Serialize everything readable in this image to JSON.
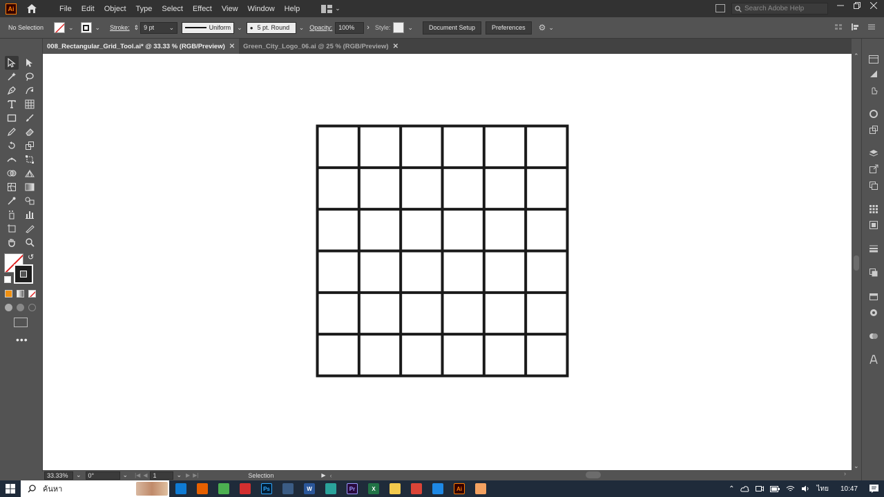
{
  "app": {
    "logo_text": "Ai",
    "search_placeholder": "Search Adobe Help"
  },
  "menu": [
    "File",
    "Edit",
    "Object",
    "Type",
    "Select",
    "Effect",
    "View",
    "Window",
    "Help"
  ],
  "control_bar": {
    "selection_label": "No Selection",
    "stroke_label": "Stroke:",
    "stroke_weight": "9 pt",
    "stroke_profile": "Uniform",
    "brush": "5 pt. Round",
    "opacity_label": "Opacity:",
    "opacity_value": "100%",
    "style_label": "Style:",
    "document_setup": "Document Setup",
    "preferences": "Preferences"
  },
  "tabs": [
    {
      "label": "008_Rectangular_Grid_Tool.ai* @ 33.33 % (RGB/Preview)",
      "active": true
    },
    {
      "label": "Green_City_Logo_06.ai @ 25 % (RGB/Preview)",
      "active": false
    }
  ],
  "canvas": {
    "grid_rows": 6,
    "grid_columns": 6,
    "stroke_color": "#1a1a1a",
    "background": "#ffffff"
  },
  "status_bar": {
    "zoom": "33.33%",
    "rotation": "0°",
    "artboard_number": "1",
    "tool_name": "Selection"
  },
  "taskbar": {
    "search_text": "ค้นหา",
    "language": "ไทย",
    "time": "10:47",
    "apps": [
      {
        "name": "edge",
        "color": "#0f7bd4"
      },
      {
        "name": "firefox",
        "color": "#e66000"
      },
      {
        "name": "paint",
        "color": "#4caf50"
      },
      {
        "name": "app-red",
        "color": "#d32f2f"
      },
      {
        "name": "photoshop",
        "color": "#001e36",
        "label": "Ps"
      },
      {
        "name": "calculator",
        "color": "#3b5c84"
      },
      {
        "name": "word",
        "color": "#2b579a",
        "label": "W"
      },
      {
        "name": "app-teal",
        "color": "#2aa39b"
      },
      {
        "name": "premiere",
        "color": "#2a0a3d",
        "label": "Pr"
      },
      {
        "name": "excel",
        "color": "#217346",
        "label": "X"
      },
      {
        "name": "file-explorer",
        "color": "#f2c94c"
      },
      {
        "name": "chrome",
        "color": "#db4437"
      },
      {
        "name": "app-blue",
        "color": "#1e88e5"
      },
      {
        "name": "illustrator",
        "color": "#330000",
        "label": "Ai"
      },
      {
        "name": "app-orange",
        "color": "#f4a261"
      }
    ]
  }
}
